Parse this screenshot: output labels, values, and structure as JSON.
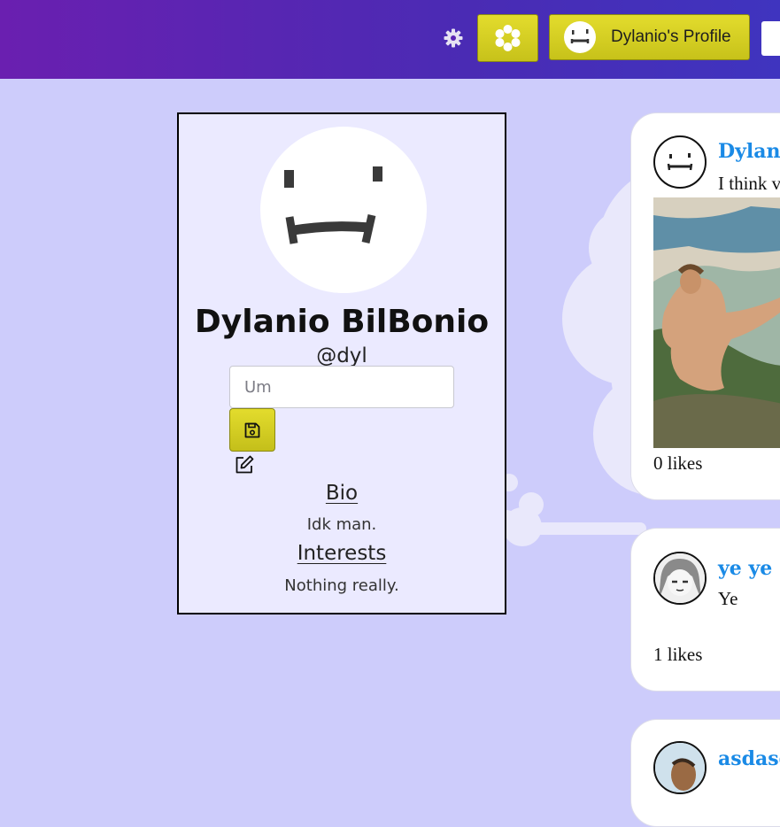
{
  "header": {
    "settings_icon": "gear-icon",
    "home_icon": "flower-icon",
    "profile_button_label": "Dylanio's Profile",
    "accent": "#d6cf22"
  },
  "profile": {
    "name": "Dylanio BilBonio",
    "handle": "@dyl",
    "input": {
      "value": "",
      "placeholder": "Um"
    },
    "save_icon": "floppy-disk-icon",
    "edit_icon": "edit-icon",
    "bio_title": "Bio",
    "bio_text": "Idk man.",
    "interests_title": "Interests",
    "interests_text": "Nothing really."
  },
  "posts": [
    {
      "author": "Dylani",
      "text": "I think v",
      "likes": "0 likes",
      "image": "creation-of-adam-painting"
    },
    {
      "author": "ye ye (",
      "text": "Ye",
      "likes": "1 likes"
    },
    {
      "author": "asdasd",
      "text": "",
      "likes": ""
    }
  ]
}
